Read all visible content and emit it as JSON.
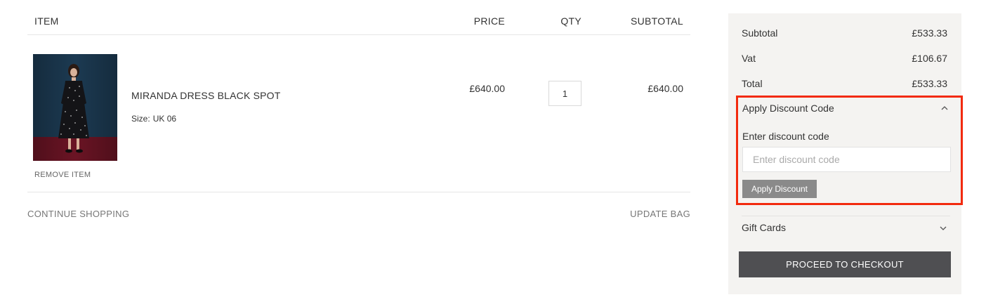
{
  "cart": {
    "headers": {
      "item": "ITEM",
      "price": "PRICE",
      "qty": "QTY",
      "subtotal": "SUBTOTAL"
    },
    "items": [
      {
        "name": "MIRANDA DRESS BLACK SPOT",
        "size_label": "Size:",
        "size_value": "UK 06",
        "price": "£640.00",
        "qty": "1",
        "subtotal": "£640.00",
        "remove_label": "REMOVE ITEM",
        "image_icon": "product-photo"
      }
    ],
    "continue_label": "CONTINUE SHOPPING",
    "update_label": "UPDATE BAG"
  },
  "summary": {
    "subtotal_label": "Subtotal",
    "subtotal_value": "£533.33",
    "vat_label": "Vat",
    "vat_value": "£106.67",
    "total_label": "Total",
    "total_value": "£533.33",
    "discount": {
      "header": "Apply Discount Code",
      "field_label": "Enter discount code",
      "placeholder": "Enter discount code",
      "value": "",
      "button": "Apply Discount",
      "expanded_icon": "chevron-up-icon"
    },
    "gift_cards": {
      "label": "Gift Cards",
      "icon": "chevron-down-icon"
    },
    "checkout_label": "PROCEED TO CHECKOUT"
  },
  "colors": {
    "summary_bg": "#f4f3f1",
    "highlight_border": "#f22a0e",
    "checkout_bg": "#4f4f52",
    "apply_bg": "#8a8a8a"
  }
}
